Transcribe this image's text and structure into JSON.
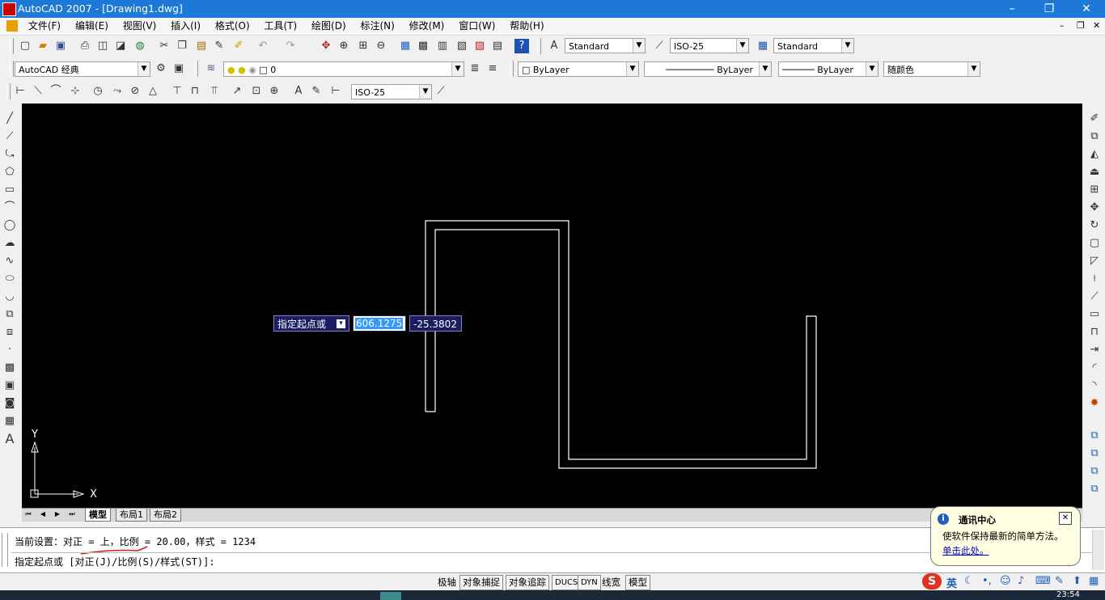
{
  "window": {
    "title": "AutoCAD 2007 - [Drawing1.dwg]",
    "minimize": "–",
    "restore": "❐",
    "close": "✕"
  },
  "menu": {
    "items": [
      "文件(F)",
      "编辑(E)",
      "视图(V)",
      "插入(I)",
      "格式(O)",
      "工具(T)",
      "绘图(D)",
      "标注(N)",
      "修改(M)",
      "窗口(W)",
      "帮助(H)"
    ]
  },
  "toolbar": {
    "text_style": "Standard",
    "dim_style": "ISO-25",
    "table_style": "Standard",
    "workspace": "AutoCAD 经典",
    "layer": "0",
    "color": "ByLayer",
    "linetype": "ByLayer",
    "lineweight": "ByLayer",
    "plot_style": "随颜色",
    "dim_style2": "ISO-25"
  },
  "ucs": {
    "x_label": "X",
    "y_label": "Y"
  },
  "dynamic_input": {
    "prompt": "指定起点或",
    "x_value": "606.1275",
    "y_value": "-25.3802"
  },
  "layout_tabs": [
    "模型",
    "布局1",
    "布局2"
  ],
  "command": {
    "line1": "当前设置：对正 = 上，比例 = 20.00，样式 = 1234",
    "line2": "指定起点或 [对正(J)/比例(S)/样式(ST)]:"
  },
  "status": {
    "buttons": [
      "极轴",
      "对象捕捉",
      "对象追踪",
      "DUCS",
      "DYN",
      "线宽",
      "模型"
    ]
  },
  "popup": {
    "title": "通讯中心",
    "body": "使软件保持最新的简单方法。",
    "link": "单击此处。"
  },
  "tray": {
    "ime": "英",
    "clock": "23:54"
  },
  "colors": {
    "canvas": "#000000",
    "titlebar": "#1e78d8",
    "dyn_input": "#1c1c60",
    "highlight": "#3399ff"
  }
}
